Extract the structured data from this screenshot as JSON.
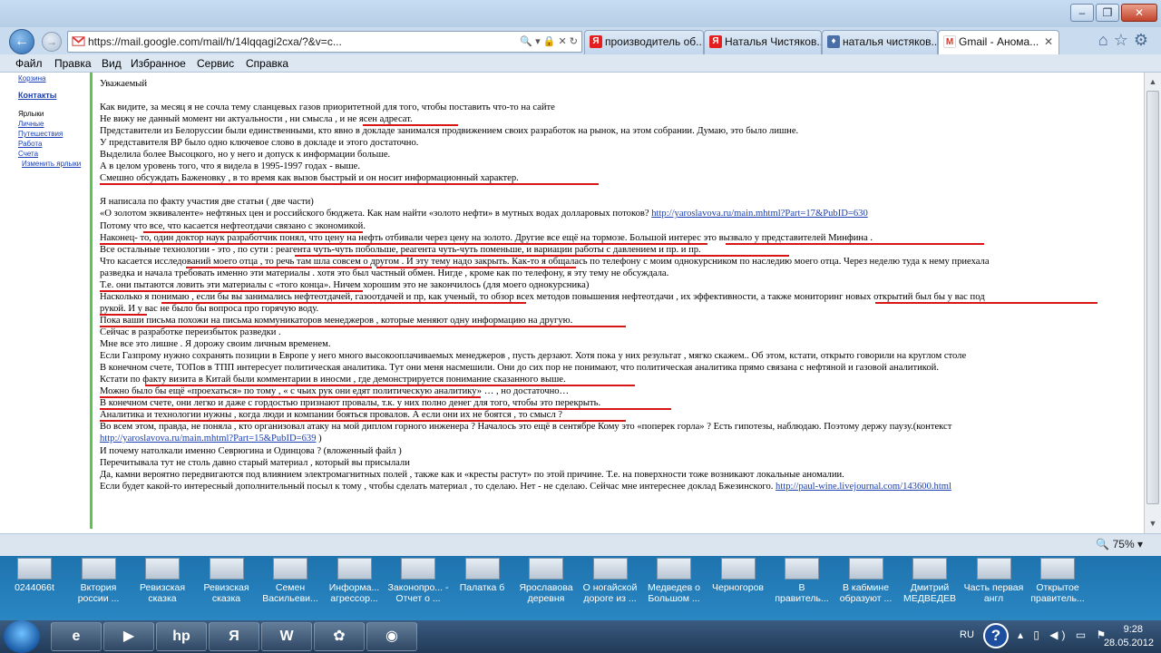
{
  "browser": {
    "address": "https://mail.google.com/mail/h/14lqqagi2cxa/?&v=c...",
    "tabs": [
      {
        "icon": "Я",
        "label": "производитель об..."
      },
      {
        "icon": "Я",
        "label": "Наталья Чистяков..."
      },
      {
        "icon": "♦",
        "label": "наталья чистяков..."
      },
      {
        "icon": "M",
        "label": "Gmail - Анома...",
        "close": "✕"
      }
    ],
    "menu": [
      "Файл",
      "Правка",
      "Вид",
      "Избранное",
      "Сервис",
      "Справка"
    ],
    "zoom": "75%"
  },
  "sidebar": {
    "basket": "Корзина",
    "contacts": "Контакты",
    "labels_title": "Ярлыки",
    "labels": [
      "Личные",
      "Путешествия",
      "Работа",
      "Счета"
    ],
    "edit_labels": "Изменить ярлыки"
  },
  "message": {
    "greeting": "Уважаемый",
    "lines": [
      "Как  видите,    за  месяц  я не сочла тему   сланцевых    газов  приоритетной  для того, чтобы   поставить что-то на сайте",
      "Не  вижу не   данный  момент ни актуальности , ни   смысла , и не ясен  адресат.",
      "Представители  из Белоруссии  были единственными,  кто явно   в докладе  занимался  продвижением   своих разработок на рынок,     на  этом собрании.  Думаю,  это было  лишне.",
      "У  представителя ВР было  одно  ключевое слово    в докладе  и этого достаточно.",
      "Выделила   более  Высоцкого, но у него и допуск  к   информации   больше.",
      "А в целом   уровень того, что   я видела в 1995-1997  годах  -   выше.",
      "Смешно обсуждать Баженовку ,  в  то время как вызов   быстрый и он носит    информационный   характер.",
      "",
      "Я   написала  по  факту  участия  две  статьи (  две части)",
      " «О золотом эквиваленте» нефтяных цен и российского бюджета. Как нам найти «золото нефти» в мутных водах долларовых потоков? ",
      "Потому  что все,   что касается нефтеотдачи   связано с экономикой.",
      "Наконец- то, один   доктор наук   разработчик     понял,   что цену на нефть отбивали через цену  на золото.   Другие все ещё на тормозе.   Большой  интерес  это вызвало у представителей Минфина .",
      " Все остальные  технологии   -  это  ,  по сути :  реагента  чуть-чуть побольше,  реагента чуть-чуть поменьше,   и     вариации  работы   с  давлением и пр. и пр.",
      " Что касается          исследований  моего отца , то речь там  шла  совсем о другом . И эту тему надо  закрыть.   Как-то  я   общалась по  телефону  с моим однокурсником по    наследию моего отца. Через неделю туда к  нему  приехала",
      "разведка и начала требовать  именно эти материалы .  хотя  это был частный  обмен.   Нигде , кроме как по телефону,   я  эту тему не  обсуждала.",
      "Т.е. они пытаются  ловить эти  материалы с  «того  конца». Ничем  хорошим  это  не закончилось (для моего однокурсника)",
      " Насколько я понимаю  , если бы   вы   занимались нефтеотдачей, газоотдачей и пр, как ученый,    то     обзор всех методов  повышения нефтеотдачи , их эффективности, а  также  мониторинг       новых открытий  был  бы  у вас под",
      "рукой. И у вас не     было бы вопроса  про горячую воду.",
      "Пока  ваши письма похожи  на письма коммуникаторов менеджеров ,  которые меняют одну информацию на другую.",
      "  Сейчас    в разработке переизбыток разведки .",
      "  Мне все  это лишне . Я дорожу своим личным   временем.",
      "Если Газпрому    нужно сохранять позиции в  Европе  у него  много высокооплачиваемых менеджеров , пусть   дерзают.    Хотя пока у них  результат , мягко скажем..   Об этом,    кстати,  открыто говорили на круглом столе",
      " В конечном счете,  ТОПов в  ТПП  интересует      политическая  аналитика.  Тут   они меня насмешили. Они до сих пор не понимают, что     политическая  аналитика  прямо связана  с нефтяной и газовой  аналитикой.",
      " Кстати     по факту визита    в   Китай  были   комментарии в иносми , где           демонстрируется понимание  сказанного выше.",
      " Можно было бы  ещё  «проехаться» по тому  ,    «  с чьих рук   они едят политическую аналитику» …  , но достаточно…",
      "В конечном счете,  они легко и даже с гордостью признают провалы, т.к. у них полно денег   для того,  чтобы  это  перекрыть.",
      "Аналитика и технологии  нужны , когда  люди и компании бояться  провалов. А если они их не боятся , то смысл ?",
      "Во всем этом, правда,   не поняла  , кто  организовал  атаку  на мой  диплом горного инженера  ?  Началось   это ещё в сентябре     Кому это «поперек  горла» ?   Есть гипотезы, наблюдаю.   Поэтому   держу паузу.(контекст",
      "",
      "  И почему  натолкали именно  Севрюгина и Одинцова ? (вложенный  файл )",
      "  Перечитывала тут  не столь  давно старый материал ,             который вы присылали",
      "  Да,  камни  вероятно передвигаются  под влиянием  электромагнитных полей ,   также как и «кресты растут»  по этой причине.   Т.е. на поверхности тоже  возникают локальные   аномалии.",
      "  Если будет  какой-то интересный    дополнительный  посыл к тому , чтобы  сделать   материал , то сделаю. Нет  -  не сделаю.  Сейчас мне интереснее  доклад Бжезинского.  "
    ],
    "link1": "http://yaroslavova.ru/main.mhtml?Part=17&PubID=630",
    "link2": "http://yaroslavova.ru/main.mhtml?Part=15&PubID=639",
    "link2_suffix": " )",
    "link3": "http://paul-wine.livejournal.com/143600.html"
  },
  "desktop_icons": [
    "0244066t",
    "Вктория россии ...",
    "Ревизская сказка",
    "Ревизская сказка",
    "Семен Васильеви...",
    "Информа... агрессор...",
    "Законопро... - Отчет о ...",
    "Палатка б",
    "Ярославова деревня",
    "О ногайской дороге из ...",
    "Медведев о Большом ...",
    "Черногоров",
    "В правитель...",
    "В кабмине образуют ...",
    "Дмитрий МЕДВЕДЕВ",
    "Часть первая англ",
    "Открытое правитель..."
  ],
  "taskbar": {
    "items": [
      "e",
      "▶",
      "hp",
      "Я",
      "W",
      "✿",
      "◉"
    ],
    "lang": "RU",
    "help": "?",
    "time": "9:28",
    "date": "28.05.2012"
  },
  "colors": {
    "accent_red": "#d91616",
    "green_bar": "#59c74a",
    "link": "#1b3fb0"
  }
}
